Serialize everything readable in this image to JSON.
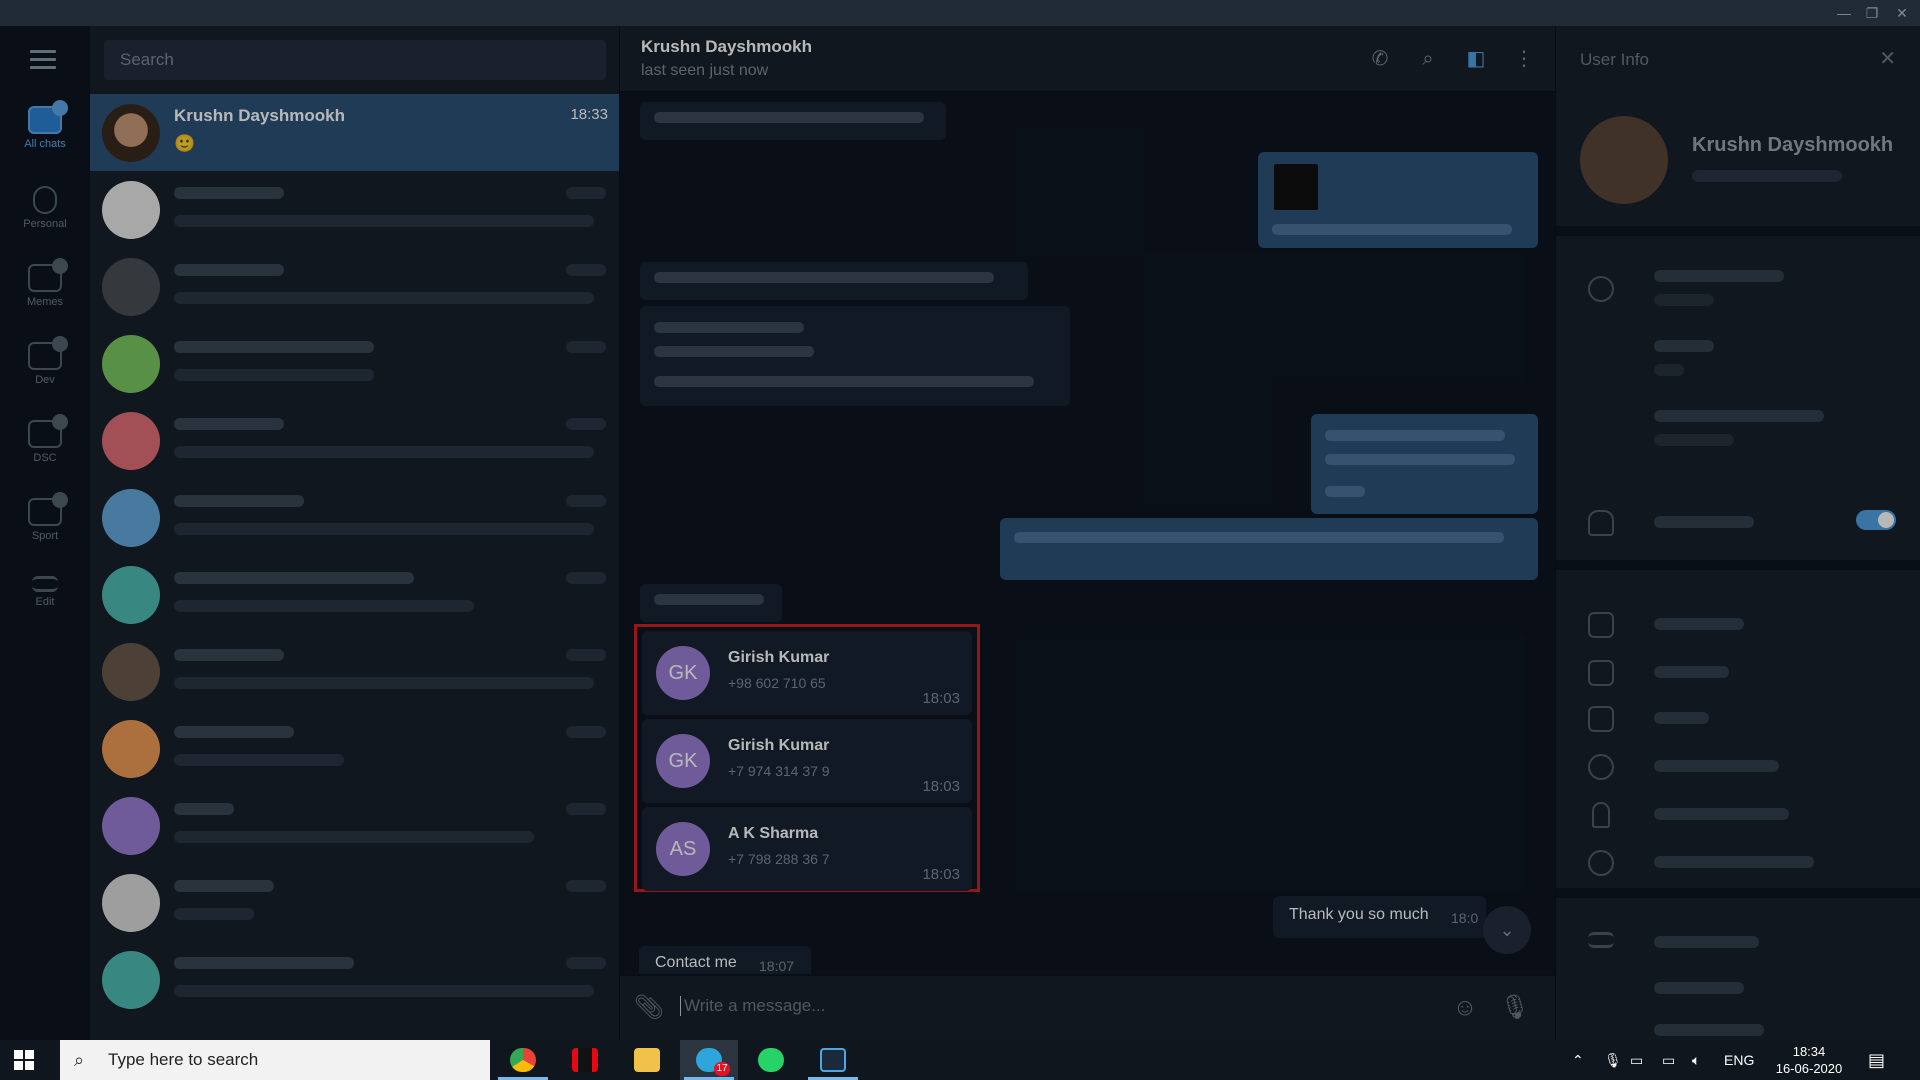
{
  "window": {
    "minimize": "—",
    "restore": "❐",
    "close": "✕"
  },
  "rail": {
    "folders": [
      {
        "label": "All chats"
      },
      {
        "label": "Personal"
      },
      {
        "label": "Memes"
      },
      {
        "label": "Dev"
      },
      {
        "label": "DSC"
      },
      {
        "label": "Sport"
      },
      {
        "label": "Edit"
      }
    ]
  },
  "chatlist": {
    "search_placeholder": "Search",
    "active": {
      "name": "Krushn Dayshmookh",
      "time": "18:33",
      "preview": "🙂"
    }
  },
  "chat": {
    "name": "Krushn Dayshmookh",
    "status": "last seen just now",
    "contacts": [
      {
        "initials": "GK",
        "name": "Girish Kumar",
        "phone": "+98 602 710 65",
        "time": "18:03",
        "color": "#9a7fd6"
      },
      {
        "initials": "GK",
        "name": "Girish Kumar",
        "phone": "+7 974 314 37 9",
        "time": "18:03",
        "color": "#9a7fd6"
      },
      {
        "initials": "AS",
        "name": "A K Sharma",
        "phone": "+7 798 288 36 7",
        "time": "18:03",
        "color": "#9a7fd6"
      }
    ],
    "thank_you": {
      "text": "Thank you so much",
      "time": "18:0"
    },
    "contact_me": {
      "text": "Contact me",
      "time": "18:07"
    },
    "composer_placeholder": "Write a message..."
  },
  "info": {
    "title": "User Info",
    "name": "Krushn Dayshmookh"
  },
  "taskbar": {
    "search_placeholder": "Type here to search",
    "telegram_badge": "17",
    "lang": "ENG",
    "time": "18:34",
    "date": "16-06-2020"
  }
}
